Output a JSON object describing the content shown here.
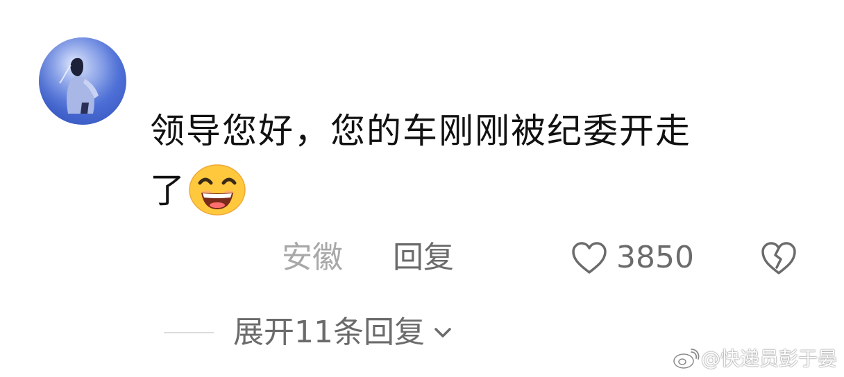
{
  "comment": {
    "line1": "领导您好，您的车刚刚被纪委开走",
    "line2": "了"
  },
  "meta": {
    "location": "安徽",
    "reply_label": "回复",
    "like_count": "3850"
  },
  "expand": {
    "label": "展开11条回复"
  },
  "watermark": {
    "text": "@快递员彭于晏"
  },
  "icons": {
    "avatar": "avatar-portrait",
    "emoji": "grinning-face-emoji",
    "like": "heart-outline-icon",
    "dislike": "broken-heart-icon",
    "chevron": "chevron-down-icon",
    "weibo": "weibo-logo"
  },
  "colors": {
    "text_primary": "#111111",
    "text_secondary": "#6b6b6b",
    "text_muted": "#a8a8a8",
    "avatar_bg": "#4d6fd6",
    "emoji_fill": "#ffc83d"
  }
}
